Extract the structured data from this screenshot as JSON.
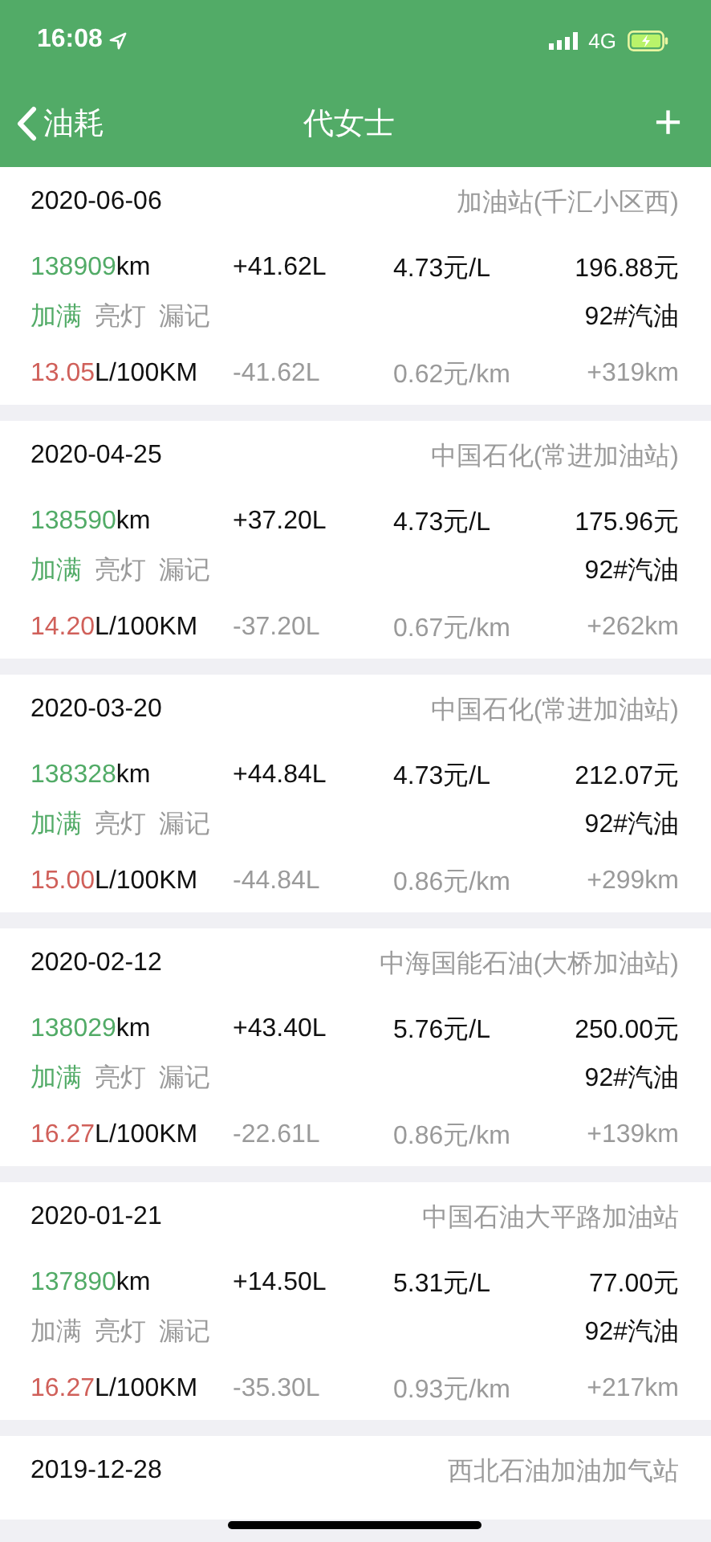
{
  "status_bar": {
    "time": "16:08",
    "network": "4G"
  },
  "nav": {
    "back": "油耗",
    "title": "代女士",
    "add": "+"
  },
  "records": [
    {
      "date": "2020-06-06",
      "station": "加油站(千汇小区西)",
      "odometer": "138909",
      "odometer_unit": "km",
      "added": "+41.62L",
      "unit_price": "4.73元/L",
      "total": "196.88元",
      "tags": [
        {
          "label": "加满",
          "on": true
        },
        {
          "label": "亮灯",
          "on": false
        },
        {
          "label": "漏记",
          "on": false
        }
      ],
      "fuel": "92#汽油",
      "consumption": "13.05",
      "consumption_unit": "L/100KM",
      "used": "-41.62L",
      "cost_per_km": "0.62元/km",
      "distance": "+319km"
    },
    {
      "date": "2020-04-25",
      "station": "中国石化(常进加油站)",
      "odometer": "138590",
      "odometer_unit": "km",
      "added": "+37.20L",
      "unit_price": "4.73元/L",
      "total": "175.96元",
      "tags": [
        {
          "label": "加满",
          "on": true
        },
        {
          "label": "亮灯",
          "on": false
        },
        {
          "label": "漏记",
          "on": false
        }
      ],
      "fuel": "92#汽油",
      "consumption": "14.20",
      "consumption_unit": "L/100KM",
      "used": "-37.20L",
      "cost_per_km": "0.67元/km",
      "distance": "+262km"
    },
    {
      "date": "2020-03-20",
      "station": "中国石化(常进加油站)",
      "odometer": "138328",
      "odometer_unit": "km",
      "added": "+44.84L",
      "unit_price": "4.73元/L",
      "total": "212.07元",
      "tags": [
        {
          "label": "加满",
          "on": true
        },
        {
          "label": "亮灯",
          "on": false
        },
        {
          "label": "漏记",
          "on": false
        }
      ],
      "fuel": "92#汽油",
      "consumption": "15.00",
      "consumption_unit": "L/100KM",
      "used": "-44.84L",
      "cost_per_km": "0.86元/km",
      "distance": "+299km"
    },
    {
      "date": "2020-02-12",
      "station": "中海国能石油(大桥加油站)",
      "odometer": "138029",
      "odometer_unit": "km",
      "added": "+43.40L",
      "unit_price": "5.76元/L",
      "total": "250.00元",
      "tags": [
        {
          "label": "加满",
          "on": true
        },
        {
          "label": "亮灯",
          "on": false
        },
        {
          "label": "漏记",
          "on": false
        }
      ],
      "fuel": "92#汽油",
      "consumption": "16.27",
      "consumption_unit": "L/100KM",
      "used": "-22.61L",
      "cost_per_km": "0.86元/km",
      "distance": "+139km"
    },
    {
      "date": "2020-01-21",
      "station": "中国石油大平路加油站",
      "odometer": "137890",
      "odometer_unit": "km",
      "added": "+14.50L",
      "unit_price": "5.31元/L",
      "total": "77.00元",
      "tags": [
        {
          "label": "加满",
          "on": false
        },
        {
          "label": "亮灯",
          "on": false
        },
        {
          "label": "漏记",
          "on": false
        }
      ],
      "fuel": "92#汽油",
      "consumption": "16.27",
      "consumption_unit": "L/100KM",
      "used": "-35.30L",
      "cost_per_km": "0.93元/km",
      "distance": "+217km"
    }
  ],
  "partial_record": {
    "date": "2019-12-28",
    "station": "西北石油加油加气站"
  }
}
